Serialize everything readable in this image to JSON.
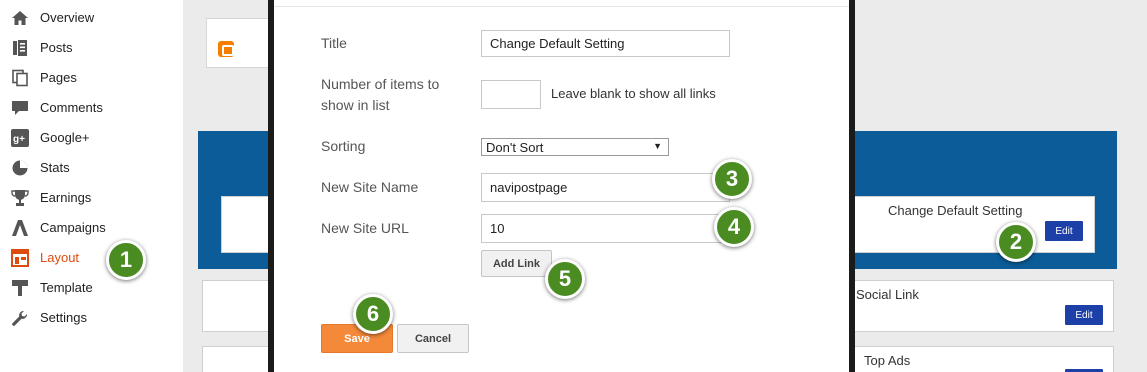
{
  "sidebar": {
    "items": [
      {
        "label": "Overview",
        "icon": "home-icon"
      },
      {
        "label": "Posts",
        "icon": "posts-icon"
      },
      {
        "label": "Pages",
        "icon": "pages-icon"
      },
      {
        "label": "Comments",
        "icon": "comment-icon"
      },
      {
        "label": "Google+",
        "icon": "google-plus-icon"
      },
      {
        "label": "Stats",
        "icon": "pie-chart-icon"
      },
      {
        "label": "Earnings",
        "icon": "trophy-icon"
      },
      {
        "label": "Campaigns",
        "icon": "campaigns-icon"
      },
      {
        "label": "Layout",
        "icon": "layout-icon",
        "active": true
      },
      {
        "label": "Template",
        "icon": "template-icon"
      },
      {
        "label": "Settings",
        "icon": "wrench-icon"
      }
    ]
  },
  "layout_editor": {
    "gadget_title": "Change Default Setting",
    "edit_label": "Edit",
    "rows": [
      {
        "title": "Social Link"
      },
      {
        "title": "Top Ads"
      }
    ]
  },
  "modal": {
    "title_label": "Title",
    "title_value": "Change Default Setting",
    "items_label_line1": "Number of items to",
    "items_label_line2": "show in list",
    "items_value": "",
    "items_hint": "Leave blank to show all links",
    "sorting_label": "Sorting",
    "sorting_value": "Don't Sort",
    "site_name_label": "New Site Name",
    "site_name_value": "navipostpage",
    "site_url_label": "New Site URL",
    "site_url_value": "10",
    "add_link_label": "Add Link",
    "save_label": "Save",
    "cancel_label": "Cancel"
  },
  "badges": [
    "1",
    "2",
    "3",
    "4",
    "5",
    "6"
  ],
  "colors": {
    "accent_orange": "#dd4b0f",
    "save_orange": "#f4893a",
    "edit_blue": "#1c3fa8",
    "band_blue": "#0b5c98",
    "badge_green": "#4a8c22",
    "blogger_orange": "#f57d00"
  }
}
